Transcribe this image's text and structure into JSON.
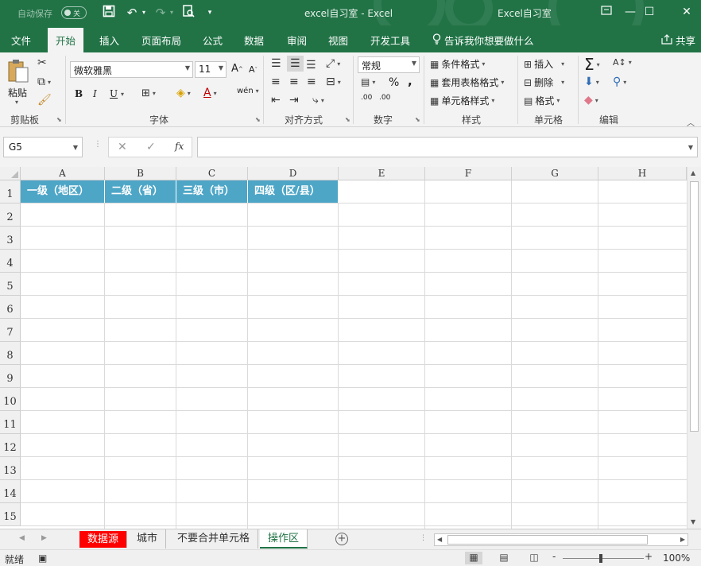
{
  "titlebar": {
    "autosave_label": "自动保存",
    "autosave_state": "关",
    "doc_title": "excel自习室  -  Excel",
    "user_title": "Excel自习室",
    "icons": [
      "save-icon",
      "undo-icon",
      "redo-icon",
      "print-preview-icon",
      "customize-qat-icon"
    ],
    "minimize": "—",
    "restore": "☐",
    "close": "✕"
  },
  "tabs": [
    {
      "label": "文件",
      "active": false
    },
    {
      "label": "开始",
      "active": true
    },
    {
      "label": "插入",
      "active": false
    },
    {
      "label": "页面布局",
      "active": false
    },
    {
      "label": "公式",
      "active": false
    },
    {
      "label": "数据",
      "active": false
    },
    {
      "label": "审阅",
      "active": false
    },
    {
      "label": "视图",
      "active": false
    },
    {
      "label": "开发工具",
      "active": false
    }
  ],
  "tell_me": "告诉我你想要做什么",
  "share": "共享",
  "ribbon": {
    "clipboard": {
      "label": "剪贴板",
      "paste": "粘贴"
    },
    "font": {
      "label": "字体",
      "name": "微软雅黑",
      "size": "11",
      "bold": "B",
      "italic": "I",
      "underline": "U"
    },
    "alignment": {
      "label": "对齐方式"
    },
    "number": {
      "label": "数字",
      "format": "常规",
      "percent": "%",
      "comma": ","
    },
    "styles": {
      "label": "样式",
      "conditional": "条件格式",
      "table": "套用表格格式",
      "cell": "单元格样式"
    },
    "cells": {
      "label": "单元格",
      "insert": "插入",
      "delete": "删除",
      "format": "格式"
    },
    "editing": {
      "label": "编辑"
    }
  },
  "formula_bar": {
    "name_box": "G5",
    "fx": "fx",
    "value": ""
  },
  "sheet": {
    "columns": [
      "A",
      "B",
      "C",
      "D",
      "E",
      "F",
      "G",
      "H"
    ],
    "rows": [
      "1",
      "2",
      "3",
      "4",
      "5",
      "6",
      "7",
      "8",
      "9",
      "10",
      "11",
      "12",
      "13",
      "14",
      "15"
    ],
    "header_cells": [
      "一级（地区）",
      "二级（省）",
      "三级（市）",
      "四级（区/县）"
    ],
    "header_color": "#4ea6c7"
  },
  "sheet_tabs": [
    {
      "label": "数据源",
      "style": "red"
    },
    {
      "label": "城市",
      "style": "normal"
    },
    {
      "label": "不要合并单元格",
      "style": "normal"
    },
    {
      "label": "操作区",
      "style": "active"
    }
  ],
  "status": {
    "ready": "就绪",
    "zoom": "100%",
    "zoom_minus": "-",
    "zoom_plus": "+"
  },
  "colors": {
    "accent": "#217346",
    "header_fill": "#4ea6c7",
    "tab_red": "#ff0000"
  }
}
